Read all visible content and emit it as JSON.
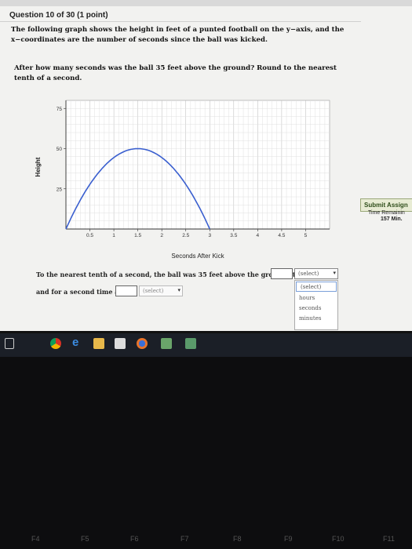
{
  "question": {
    "title": "Question 10 of 30 (1 point)",
    "line1": "The following graph shows the height in feet of a punted football on the y−axis, and the",
    "line2": "x−coordinates are the number of seconds since the ball was kicked.",
    "prompt1": "After how many seconds was the ball 35 feet above the ground? Round to the nearest",
    "prompt2": "tenth of a second."
  },
  "chart_data": {
    "type": "line",
    "xlabel": "Seconds After Kick",
    "ylabel": "Height",
    "xlim": [
      0,
      5.5
    ],
    "ylim": [
      0,
      80
    ],
    "xticks": [
      "0.5",
      "1",
      "1.5",
      "2",
      "2.5",
      "3",
      "3.5",
      "4",
      "4.5",
      "5"
    ],
    "yticks": [
      "25",
      "50",
      "75"
    ],
    "grid": true,
    "curve": {
      "shape": "parabola",
      "vertex": [
        1.5,
        50
      ],
      "x_intercepts": [
        0,
        3
      ]
    }
  },
  "answer": {
    "text1": "To the nearest tenth of a second, the ball was 35 feet above the ground at",
    "text2": "and for a second time at",
    "select1": "(select)",
    "select2": "(select)",
    "options": [
      "(select)",
      "hours",
      "seconds",
      "minutes"
    ]
  },
  "sidebar": {
    "submit_label": "Submit Assign",
    "time_label": "Time Remainin",
    "time_value": "157 Min."
  },
  "fkeys": [
    "F4",
    "F5",
    "F6",
    "F7",
    "F8",
    "F9",
    "F10",
    "F11"
  ]
}
